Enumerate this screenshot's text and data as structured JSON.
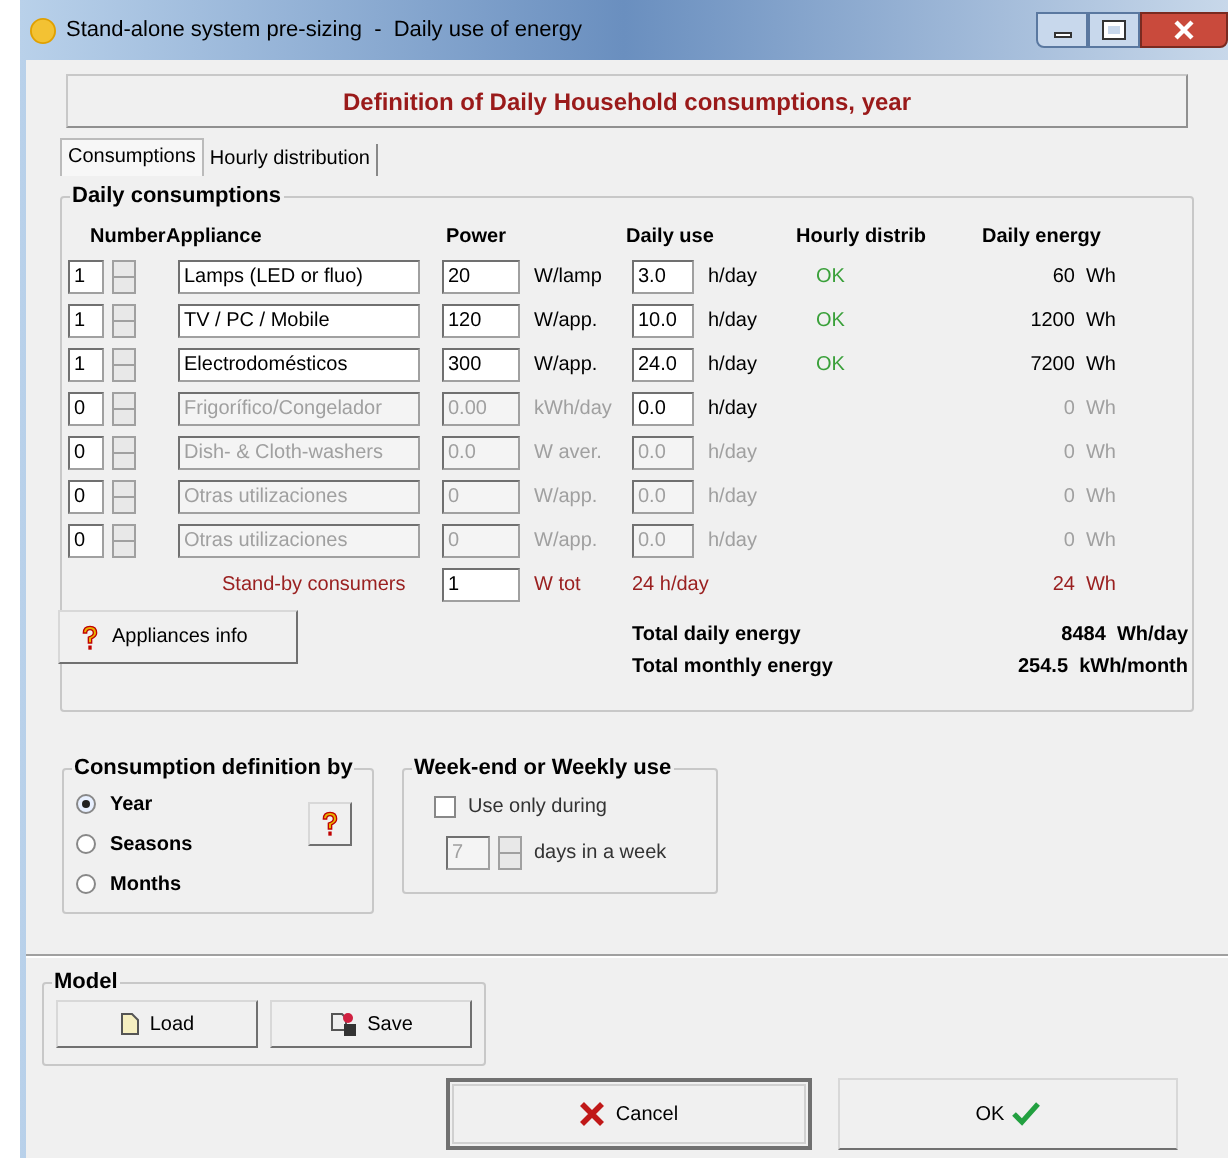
{
  "window": {
    "title": "Stand-alone system pre-sizing  -  Daily use of energy"
  },
  "header": "Definition of Daily Household consumptions, year",
  "tabs": [
    {
      "label": "Consumptions",
      "selected": true
    },
    {
      "label": "Hourly distribution",
      "selected": false
    }
  ],
  "daily_consumptions": {
    "title": "Daily consumptions",
    "columns": [
      "Number",
      "Appliance",
      "Power",
      "Daily use",
      "Hourly distrib",
      "Daily energy"
    ],
    "rows": [
      {
        "number": "1",
        "appliance": "Lamps (LED or fluo)",
        "power": "20",
        "power_unit": "W/lamp",
        "daily_use": "3.0",
        "daily_use_unit": "h/day",
        "hourly_distrib": "OK",
        "daily_energy": "60  Wh",
        "disabled": false,
        "use_disabled": false
      },
      {
        "number": "1",
        "appliance": "TV / PC / Mobile",
        "power": "120",
        "power_unit": "W/app.",
        "daily_use": "10.0",
        "daily_use_unit": "h/day",
        "hourly_distrib": "OK",
        "daily_energy": "1200  Wh",
        "disabled": false,
        "use_disabled": false
      },
      {
        "number": "1",
        "appliance": "Electrodomésticos",
        "power": "300",
        "power_unit": "W/app.",
        "daily_use": "24.0",
        "daily_use_unit": "h/day",
        "hourly_distrib": "OK",
        "daily_energy": "7200  Wh",
        "disabled": false,
        "use_disabled": false
      },
      {
        "number": "0",
        "appliance": "Frigorífico/Congelador",
        "power": "0.00",
        "power_unit": "kWh/day",
        "daily_use": "0.0",
        "daily_use_unit": "h/day",
        "daily_energy": "0  Wh",
        "disabled": true,
        "use_disabled": false
      },
      {
        "number": "0",
        "appliance": "Dish- & Cloth-washers",
        "power": "0.0",
        "power_unit": "W aver.",
        "daily_use": "0.0",
        "daily_use_unit": "h/day",
        "daily_energy": "0  Wh",
        "disabled": true,
        "use_disabled": true
      },
      {
        "number": "0",
        "appliance": "Otras utilizaciones",
        "power": "0",
        "power_unit": "W/app.",
        "daily_use": "0.0",
        "daily_use_unit": "h/day",
        "daily_energy": "0  Wh",
        "disabled": true,
        "use_disabled": true
      },
      {
        "number": "0",
        "appliance": "Otras utilizaciones",
        "power": "0",
        "power_unit": "W/app.",
        "daily_use": "0.0",
        "daily_use_unit": "h/day",
        "daily_energy": "0  Wh",
        "disabled": true,
        "use_disabled": true
      }
    ],
    "standby": {
      "label": "Stand-by consumers",
      "power": "1",
      "power_unit": "W tot",
      "daily_use": "24 h/day",
      "daily_energy": "24  Wh"
    },
    "appliances_info_button": "Appliances info",
    "totals": [
      {
        "label": "Total daily energy",
        "value": "8484  Wh/day"
      },
      {
        "label": "Total monthly energy",
        "value": "254.5  kWh/month"
      }
    ]
  },
  "consumption_definition": {
    "title": "Consumption definition by",
    "options": [
      {
        "label": "Year",
        "selected": true
      },
      {
        "label": "Seasons",
        "selected": false
      },
      {
        "label": "Months",
        "selected": false
      }
    ]
  },
  "weekly_use": {
    "title": "Week-end or Weekly use",
    "checkbox": {
      "label": "Use only during",
      "checked": false
    },
    "days": "7",
    "days_label": "days in a week"
  },
  "model": {
    "title": "Model",
    "buttons": [
      "Load",
      "Save"
    ]
  },
  "cancel_button": "Cancel",
  "ok_button": "OK"
}
